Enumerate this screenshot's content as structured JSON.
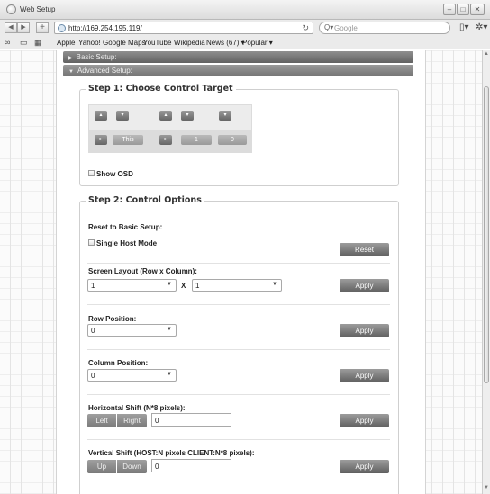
{
  "window": {
    "title": "Web Setup"
  },
  "toolbar": {
    "url": "http://169.254.195.119/",
    "search_placeholder": "Google"
  },
  "bookmarks": [
    "Apple",
    "Yahoo!",
    "Google Maps",
    "YouTube",
    "Wikipedia",
    "News (67) ▾",
    "Popular ▾"
  ],
  "accordion": {
    "basic": "Basic Setup:",
    "advanced": "Advanced Setup:"
  },
  "step1": {
    "title": "Step 1: Choose Control Target",
    "this_label": "This",
    "num1": "1",
    "num2": "0",
    "show_osd": "Show OSD"
  },
  "step2": {
    "title": "Step 2: Control Options",
    "reset_heading": "Reset to Basic Setup:",
    "single_host": "Single Host Mode",
    "reset_btn": "Reset",
    "screen_layout": {
      "label": "Screen Layout (Row x Column):",
      "rows": "1",
      "x": "X",
      "cols": "1",
      "apply": "Apply"
    },
    "row_position": {
      "label": "Row Position:",
      "value": "0",
      "apply": "Apply"
    },
    "column_position": {
      "label": "Column Position:",
      "value": "0",
      "apply": "Apply"
    },
    "horizontal_shift": {
      "label": "Horizontal Shift (N*8 pixels):",
      "left": "Left",
      "right": "Right",
      "value": "0",
      "apply": "Apply"
    },
    "vertical_shift": {
      "label": "Vertical Shift (HOST:N pixels CLIENT:N*8 pixels):",
      "up": "Up",
      "down": "Down",
      "value": "0",
      "apply": "Apply"
    }
  }
}
